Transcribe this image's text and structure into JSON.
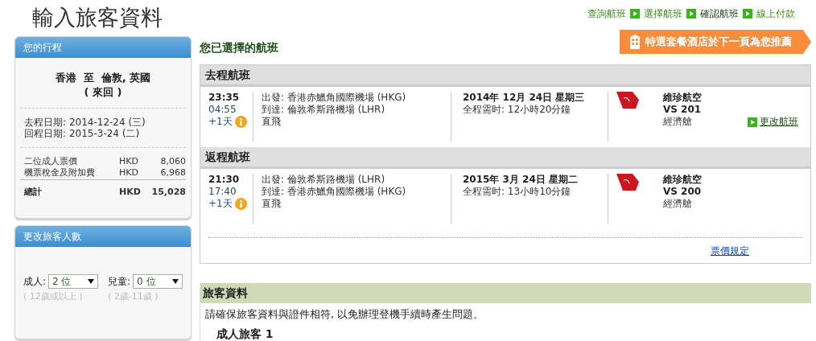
{
  "page_title": "輸入旅客資料",
  "steps": [
    {
      "label": "查詢航班",
      "selected": false
    },
    {
      "label": "選擇航班",
      "selected": false
    },
    {
      "label": "確認航班",
      "selected": true
    },
    {
      "label": "線上付款",
      "selected": false
    }
  ],
  "promo_banner": {
    "text": "特選套餐酒店於下一頁為您推薦"
  },
  "itinerary": {
    "title": "您的行程",
    "route": "香港  至  倫敦, 英國",
    "trip_type": "( 來回 )",
    "dates": [
      {
        "label": "去程日期:",
        "value": "2014-12-24 (三)"
      },
      {
        "label": "回程日期:",
        "value": "2015-3-24 (二)"
      }
    ],
    "fares": [
      {
        "label": "二位成人票價",
        "currency": "HKD",
        "amount": "8,060"
      },
      {
        "label": "機票稅金及附加費",
        "currency": "HKD",
        "amount": "6,968"
      }
    ],
    "total": {
      "label": "總計",
      "currency": "HKD",
      "amount": "15,028"
    }
  },
  "passenger_count": {
    "title": "更改旅客人數",
    "fields": [
      {
        "label": "成人:",
        "value": "2 位",
        "hint": "( 12歲或以上 )"
      },
      {
        "label": "兒童:",
        "value": "0 位",
        "hint": "( 2歲-11歲 )"
      }
    ]
  },
  "selected_flights": {
    "title": "您已選擇的航班",
    "segments": [
      {
        "title": "去程航班",
        "depart_time": "23:35",
        "arrive_time": "04:55",
        "day_offset": "+1天",
        "departure": "出發: 香港赤鱲角國際機場 (HKG)",
        "arrival": "到達: 倫敦希斯路機場 (LHR)",
        "stops": "直飛",
        "date": "2014年 12月 24日 星期三",
        "duration": "全程需时: 12小時20分鐘",
        "airline": "維珍航空",
        "flight_no": "VS 201",
        "cabin": "經濟艙",
        "change_link": "更改航班"
      },
      {
        "title": "返程航班",
        "depart_time": "21:30",
        "arrive_time": "17:40",
        "day_offset": "+1天",
        "departure": "出發: 倫敦希斯路機場 (LHR)",
        "arrival": "到達: 香港赤鱲角國際機場 (HKG)",
        "stops": "直飛",
        "date": "2015年 3月 24日 星期二",
        "duration": "全程需时: 13小時10分鐘",
        "airline": "維珍航空",
        "flight_no": "VS 200",
        "cabin": "經濟艙"
      }
    ],
    "fare_rules_link": "票價規定"
  },
  "traveller_info": {
    "title": "旅客資料",
    "notice": "請確保旅客資料與證件相符, 以免辦理登機手續時產生問題。",
    "subheading": "成人旅客 1"
  }
}
